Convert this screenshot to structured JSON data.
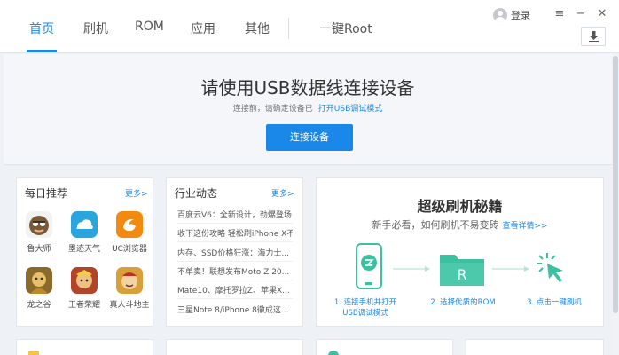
{
  "nav": {
    "tabs": [
      "首页",
      "刷机",
      "ROM",
      "应用",
      "其他"
    ],
    "root": "一键Root",
    "login": "登录"
  },
  "hero": {
    "title": "请使用USB数据线连接设备",
    "hint": "连接前，请确定设备已",
    "link": "打开USB调试模式",
    "button": "连接设备"
  },
  "daily": {
    "title": "每日推荐",
    "more": "更多>",
    "apps": [
      {
        "name": "鲁大师",
        "icon": "ludashi-icon",
        "color": "#5a9a4a"
      },
      {
        "name": "墨迹天气",
        "icon": "moji-weather-icon",
        "color": "#2ba5de"
      },
      {
        "name": "UC浏览器",
        "icon": "uc-browser-icon",
        "color": "#f28a12"
      },
      {
        "name": "龙之谷",
        "icon": "dragon-nest-icon",
        "color": "#b58a34"
      },
      {
        "name": "王者荣耀",
        "icon": "honor-of-kings-icon",
        "color": "#c0542a"
      },
      {
        "name": "真人斗地主",
        "icon": "doudizhu-icon",
        "color": "#d9a03a"
      }
    ]
  },
  "news": {
    "title": "行业动态",
    "more": "更多>",
    "items": [
      "百度云V6：全新设计，劲爆登场",
      "收下这份攻略 轻松刷iPhone X不...",
      "内存、SSD价格狂涨：海力士...",
      "不单卖！联想发布Moto Z 20...",
      "Mate10、摩托罗拉Z、苹果X...",
      "三星Note 8/iPhone 8徹成这..."
    ]
  },
  "promo": {
    "title": "超级刷机秘籍",
    "subtitle": "新手必看，如何刷机不易变砖",
    "link": "查看详情>>",
    "steps": [
      {
        "label": "1. 连接手机并打开",
        "label2": "USB调试模式"
      },
      {
        "label": "2. 选择优质的ROM",
        "label2": ""
      },
      {
        "label": "3. 点击一键刷机",
        "label2": ""
      }
    ],
    "rom_letter": "R"
  },
  "colors": {
    "accent": "#1a88e8",
    "step_green": "#3cc0a0"
  }
}
